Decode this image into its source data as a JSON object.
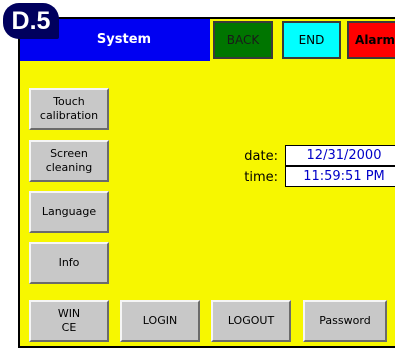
{
  "badge": "D.5",
  "title": "System",
  "top_buttons": {
    "back": "BACK",
    "end": "END",
    "alarm": "Alarm"
  },
  "side_buttons": {
    "touch": [
      "Touch",
      "calibration"
    ],
    "screen": [
      "Screen",
      "cleaning"
    ],
    "language": "Language",
    "info": "Info"
  },
  "bottom_buttons": {
    "wince": [
      "WIN",
      "CE"
    ],
    "login": "LOGIN",
    "logout": "LOGOUT",
    "password": "Password"
  },
  "datetime": {
    "date_label": "date:",
    "date_value": "12/31/2000",
    "time_label": "time:",
    "time_value": "11:59:51 PM"
  },
  "colors": {
    "background": "#f7f700",
    "title_bar": "#0000f2",
    "back": "#007500",
    "end": "#00ffff",
    "alarm": "#ff0000",
    "badge": "#00005e"
  }
}
